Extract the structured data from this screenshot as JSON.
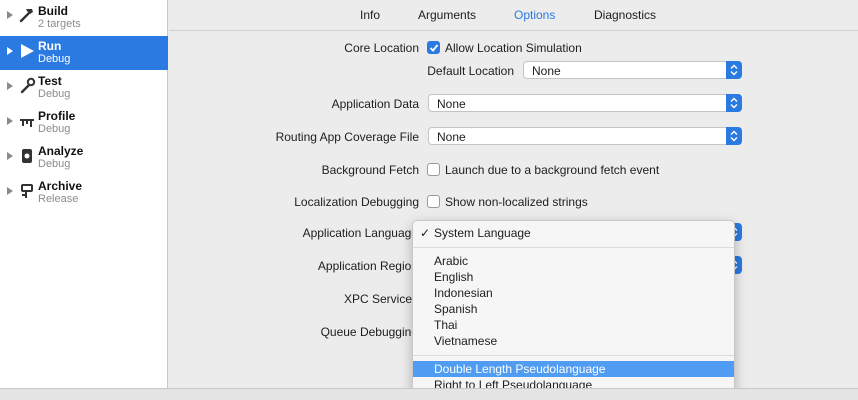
{
  "sidebar": {
    "items": [
      {
        "title": "Build",
        "subtitle": "2 targets",
        "icon": "hammer-icon"
      },
      {
        "title": "Run",
        "subtitle": "Debug",
        "icon": "play-icon"
      },
      {
        "title": "Test",
        "subtitle": "Debug",
        "icon": "wrench-icon"
      },
      {
        "title": "Profile",
        "subtitle": "Debug",
        "icon": "gauge-icon"
      },
      {
        "title": "Analyze",
        "subtitle": "Debug",
        "icon": "analyze-icon"
      },
      {
        "title": "Archive",
        "subtitle": "Release",
        "icon": "archive-icon"
      }
    ]
  },
  "tabs": {
    "info": "Info",
    "arguments": "Arguments",
    "options": "Options",
    "diagnostics": "Diagnostics",
    "active": "Options"
  },
  "options": {
    "core_location": {
      "label": "Core Location",
      "checkbox_label": "Allow Location Simulation",
      "checked": true
    },
    "default_location": {
      "label": "Default Location",
      "value": "None"
    },
    "application_data": {
      "label": "Application Data",
      "value": "None"
    },
    "routing_coverage": {
      "label": "Routing App Coverage File",
      "value": "None"
    },
    "background_fetch": {
      "label": "Background Fetch",
      "checkbox_label": "Launch due to a background fetch event",
      "checked": false
    },
    "localization_debugging": {
      "label": "Localization Debugging",
      "checkbox_label": "Show non-localized strings",
      "checked": false
    },
    "application_language": {
      "label": "Application Language"
    },
    "application_region": {
      "label": "Application Region"
    },
    "xpc_services": {
      "label": "XPC Services"
    },
    "queue_debugging": {
      "label": "Queue Debugging"
    }
  },
  "language_menu": {
    "selected": "System Language",
    "check_mark": "✓",
    "languages": [
      "Arabic",
      "English",
      "Indonesian",
      "Spanish",
      "Thai",
      "Vietnamese"
    ],
    "pseudo": [
      "Double Length Pseudolanguage",
      "Right to Left Pseudolanguage"
    ],
    "highlighted": "Double Length Pseudolanguage"
  },
  "colors": {
    "accent": "#2a7ae2",
    "menu_highlight": "#4f9cf2"
  }
}
